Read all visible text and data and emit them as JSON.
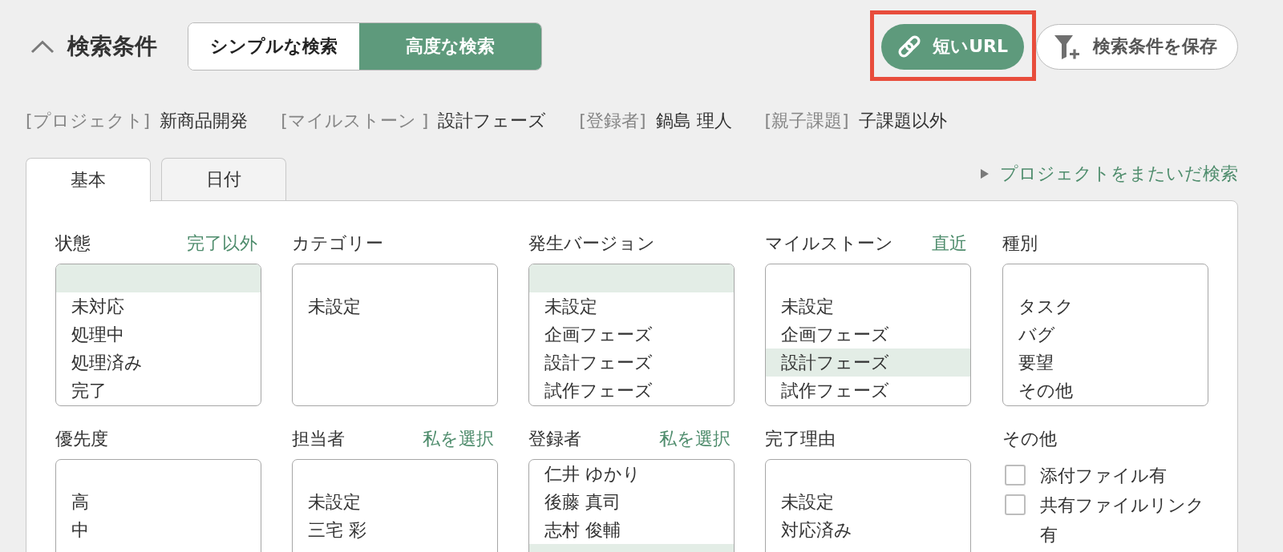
{
  "header": {
    "title": "検索条件",
    "expanded": true,
    "modes": [
      {
        "label": "シンプルな検索",
        "selected": false
      },
      {
        "label": "高度な検索",
        "selected": true
      }
    ],
    "actions": [
      {
        "kind": "short-url",
        "label": "短いURL",
        "highlighted": true
      },
      {
        "kind": "save",
        "label": "検索条件を保存",
        "highlighted": false
      }
    ]
  },
  "summary": [
    {
      "label": "[プロジェクト]",
      "value": "新商品開発"
    },
    {
      "label": "[マイルストーン ]",
      "value": "設計フェーズ"
    },
    {
      "label": "[登録者]",
      "value": "鍋島 理人"
    },
    {
      "label": "[親子課題]",
      "value": "子課題以外"
    }
  ],
  "tabs": [
    {
      "label": "基本",
      "selected": true
    },
    {
      "label": "日付",
      "selected": false
    }
  ],
  "cross_project_link": {
    "label": "プロジェクトをまたいだ検索"
  },
  "fields": [
    {
      "kind": "listbox",
      "label": "状態",
      "link": "完了以外",
      "options": [
        {
          "kind": "blank",
          "selected": true
        },
        {
          "kind": "text",
          "label": "未対応",
          "selected": false
        },
        {
          "kind": "text",
          "label": "処理中",
          "selected": false
        },
        {
          "kind": "text",
          "label": "処理済み",
          "selected": false
        },
        {
          "kind": "text",
          "label": "完了",
          "selected": false
        }
      ]
    },
    {
      "kind": "listbox",
      "label": "カテゴリー",
      "options": [
        {
          "kind": "blank",
          "selected": false
        },
        {
          "kind": "text",
          "label": "未設定",
          "selected": false
        }
      ]
    },
    {
      "kind": "listbox",
      "label": "発生バージョン",
      "options": [
        {
          "kind": "blank",
          "selected": true
        },
        {
          "kind": "text",
          "label": "未設定",
          "selected": false
        },
        {
          "kind": "text",
          "label": "企画フェーズ",
          "selected": false
        },
        {
          "kind": "text",
          "label": "設計フェーズ",
          "selected": false
        },
        {
          "kind": "text",
          "label": "試作フェーズ",
          "selected": false
        }
      ]
    },
    {
      "kind": "listbox",
      "label": "マイルストーン",
      "link": "直近",
      "options": [
        {
          "kind": "blank",
          "selected": false
        },
        {
          "kind": "text",
          "label": "未設定",
          "selected": false
        },
        {
          "kind": "text",
          "label": "企画フェーズ",
          "selected": false
        },
        {
          "kind": "text",
          "label": "設計フェーズ",
          "selected": true
        },
        {
          "kind": "text",
          "label": "試作フェーズ",
          "selected": false
        }
      ]
    },
    {
      "kind": "listbox",
      "label": "種別",
      "options": [
        {
          "kind": "blank",
          "selected": false
        },
        {
          "kind": "text",
          "label": "タスク",
          "selected": false
        },
        {
          "kind": "text",
          "label": "バグ",
          "selected": false
        },
        {
          "kind": "text",
          "label": "要望",
          "selected": false
        },
        {
          "kind": "text",
          "label": "その他",
          "selected": false
        }
      ]
    },
    {
      "kind": "listbox",
      "label": "優先度",
      "options": [
        {
          "kind": "blank",
          "selected": false
        },
        {
          "kind": "text",
          "label": "高",
          "selected": false
        },
        {
          "kind": "text",
          "label": "中",
          "selected": false
        }
      ]
    },
    {
      "kind": "listbox",
      "label": "担当者",
      "link": "私を選択",
      "options": [
        {
          "kind": "blank",
          "selected": false
        },
        {
          "kind": "text",
          "label": "未設定",
          "selected": false
        },
        {
          "kind": "text",
          "label": "三宅 彩",
          "selected": false
        }
      ]
    },
    {
      "kind": "listbox",
      "label": "登録者",
      "link": "私を選択",
      "options": [
        {
          "kind": "text",
          "label": "仁井 ゆかり",
          "selected": false
        },
        {
          "kind": "text",
          "label": "後藤 真司",
          "selected": false
        },
        {
          "kind": "text",
          "label": "志村 俊輔",
          "selected": false
        },
        {
          "kind": "cut",
          "selected": true
        }
      ]
    },
    {
      "kind": "listbox",
      "label": "完了理由",
      "options": [
        {
          "kind": "blank",
          "selected": false
        },
        {
          "kind": "text",
          "label": "未設定",
          "selected": false
        },
        {
          "kind": "text",
          "label": "対応済み",
          "selected": false
        }
      ]
    },
    {
      "kind": "checkboxes",
      "label": "その他",
      "items": [
        {
          "label": "添付ファイル有",
          "checked": false
        },
        {
          "label": "共有ファイルリンク有",
          "checked": false
        }
      ]
    }
  ]
}
